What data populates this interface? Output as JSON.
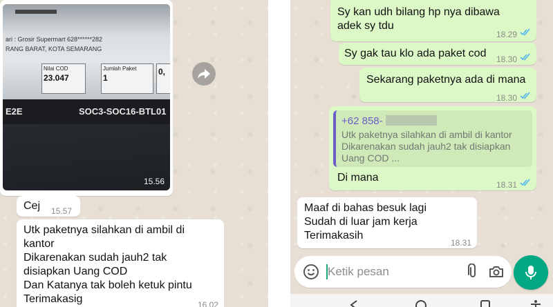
{
  "left_chat": {
    "image_message": {
      "photo": {
        "sender_line": "ari : Grosir Supermart 628******282",
        "address_line": "RANG BARAT, KOTA SEMARANG",
        "cod_label": "Nilai COD",
        "cod_value": "23.047",
        "qty_label": "Jumlah Paket",
        "qty_value": "1",
        "extra_cell": "0,",
        "route_left": "E2E",
        "route_code": "SOC3-SOC16-BTL01"
      },
      "time": "15.56"
    },
    "messages": [
      {
        "text": "Cej",
        "time": "15.57"
      },
      {
        "lines": [
          "Utk paketnya silahkan di ambil di",
          "kantor",
          "Dikarenakan sudah jauh2 tak",
          "disiapkan Uang COD",
          "Dan Katanya tak boleh ketuk pintu",
          "Terimakasig"
        ],
        "time": "16.02"
      }
    ],
    "forward_icon": "forward-icon"
  },
  "right_chat": {
    "messages": [
      {
        "lines": [
          "Sy kan udh bilang hp nya dibawa",
          "adek sy tdu"
        ],
        "time": "18.29",
        "status": "read"
      },
      {
        "text": "Sy gak tau klo ada paket cod",
        "time": "18.30",
        "status": "read"
      },
      {
        "text": "Sekarang paketnya ada di mana",
        "time": "18.30",
        "status": "read"
      },
      {
        "quote": {
          "name": "+62 858-",
          "lines": [
            "Utk paketnya silahkan di ambil di kantor",
            "Dikarenakan sudah jauh2 tak disiapkan",
            "Uang COD ..."
          ]
        },
        "text": "Di mana",
        "time": "18.31",
        "status": "read"
      },
      {
        "lines": [
          "Maaf di bahas besuk lagi",
          "Sudah di luar jam kerja",
          "Terimakasih"
        ],
        "time": "18.31"
      }
    ],
    "composer": {
      "placeholder": "Ketik pesan",
      "emoji_icon": "emoji-icon",
      "attach_icon": "paperclip-icon",
      "camera_icon": "camera-icon",
      "mic_icon": "mic-icon"
    }
  },
  "colors": {
    "outgoing": "#dcf8c6",
    "incoming": "#ffffff",
    "chat_bg": "#e7dfd4",
    "read_ticks": "#4fb6ec",
    "accent": "#00a884",
    "quote_bar": "#6c5fc9"
  }
}
